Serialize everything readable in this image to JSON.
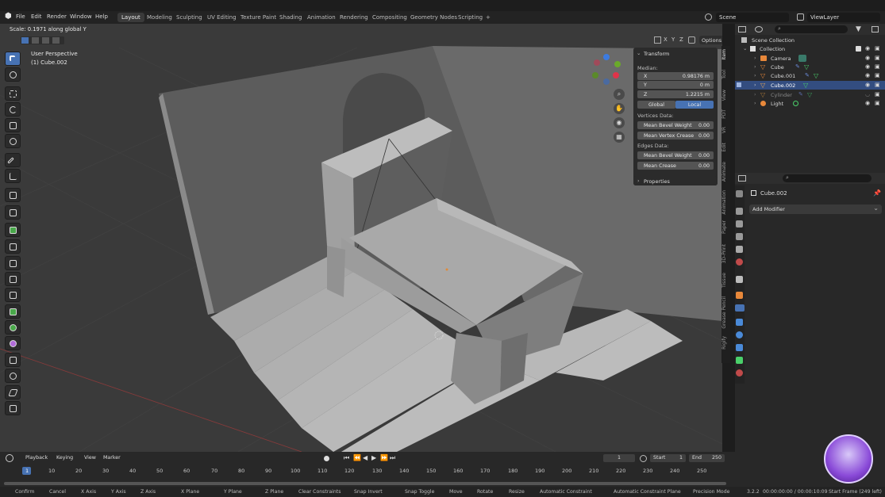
{
  "app": {
    "version": "3.2.2",
    "window_status": "00:00:00:00 / 00:00:10:09",
    "start_frame_info": "Start Frame (249 left)"
  },
  "menus": [
    "File",
    "Edit",
    "Render",
    "Window",
    "Help"
  ],
  "workspaces": [
    "Layout",
    "Modeling",
    "Sculpting",
    "UV Editing",
    "Texture Paint",
    "Shading",
    "Animation",
    "Rendering",
    "Compositing",
    "Geometry Nodes",
    "Scripting"
  ],
  "workspace_add": "+",
  "scene": {
    "name": "Scene",
    "view_layer": "ViewLayer"
  },
  "viewport": {
    "header_status": "Scale: 0.1971 along global Y",
    "perspective": "User Perspective",
    "object_label": "(1) Cube.002",
    "options_label": "Options",
    "axes": [
      "X",
      "Y",
      "Z"
    ]
  },
  "npanel": {
    "section": "Transform",
    "median_label": "Median:",
    "x_label": "X",
    "x_value": "0.98176 m",
    "y_label": "Y",
    "y_value": "0 m",
    "z_label": "Z",
    "z_value": "1.2215 m",
    "global_label": "Global",
    "local_label": "Local",
    "vertices_data": "Vertices Data:",
    "mean_bevel_weight_label": "Mean Bevel Weight",
    "vbw_value": "0.00",
    "mean_vertex_crease_label": "Mean Vertex Crease",
    "vvc_value": "0.00",
    "edges_data": "Edges Data:",
    "ebw_label": "Mean Bevel Weight",
    "ebw_value": "0.00",
    "mean_crease_label": "Mean Crease",
    "mc_value": "0.00",
    "properties": "Properties"
  },
  "npanel_tabs": [
    "Item",
    "Tool",
    "View",
    "PDT",
    "VR",
    "Edit",
    "Animate",
    "Animation",
    "Paper",
    "3D-Print",
    "Tissue",
    "Grease Pencil",
    "Rigify"
  ],
  "outliner": {
    "root": "Scene Collection",
    "collection": "Collection",
    "items": [
      {
        "name": "Camera",
        "dim": false
      },
      {
        "name": "Cube",
        "dim": false
      },
      {
        "name": "Cube.001",
        "dim": false
      },
      {
        "name": "Cube.002",
        "dim": false
      },
      {
        "name": "Cylinder",
        "dim": true
      },
      {
        "name": "Light",
        "dim": false
      }
    ]
  },
  "properties": {
    "object": "Cube.002",
    "add_modifier": "Add Modifier"
  },
  "timeline": {
    "menus": [
      "Playback",
      "Keying",
      "View",
      "Marker"
    ],
    "current_frame": "1",
    "start_label": "Start",
    "start_value": "1",
    "end_label": "End",
    "end_value": "250",
    "ticks": [
      "1",
      "10",
      "20",
      "30",
      "40",
      "50",
      "60",
      "70",
      "80",
      "90",
      "100",
      "110",
      "120",
      "130",
      "140",
      "150",
      "160",
      "170",
      "180",
      "190",
      "200",
      "210",
      "220",
      "230",
      "240",
      "250"
    ]
  },
  "statusbar": {
    "confirm": "Confirm",
    "cancel": "Cancel",
    "x_axis": "X Axis",
    "y_axis": "Y Axis",
    "z_axis": "Z Axis",
    "x_plane": "X Plane",
    "y_plane": "Y Plane",
    "z_plane": "Z Plane",
    "clear_constraints": "Clear Constraints",
    "snap_invert": "Snap Invert",
    "snap_toggle": "Snap Toggle",
    "move": "Move",
    "rotate": "Rotate",
    "resize": "Resize",
    "auto_constraint": "Automatic Constraint",
    "auto_constraint_plane": "Automatic Constraint Plane",
    "precision_mode": "Precision Mode"
  },
  "colors": {
    "accent": "#4772b3",
    "selected_row": "#334d80",
    "viewport_bg": "#3a3a3a"
  }
}
